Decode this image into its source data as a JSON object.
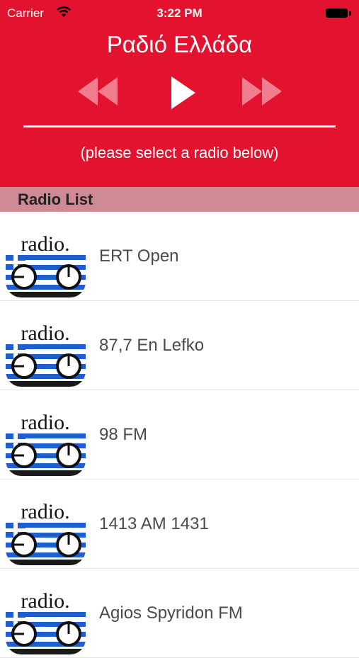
{
  "status_bar": {
    "carrier": "Carrier",
    "time": "3:22 PM"
  },
  "player": {
    "title": "Ραδιό Ελλάδα",
    "hint": "(please select a radio below)",
    "controls": {
      "rewind": "rewind-icon",
      "play": "play-icon",
      "forward": "fast-forward-icon"
    }
  },
  "section": {
    "title": "Radio List"
  },
  "radios": [
    {
      "name": "ERT Open",
      "icon_text": "radio."
    },
    {
      "name": "87,7 En Lefko",
      "icon_text": "radio."
    },
    {
      "name": "98 FM",
      "icon_text": "radio."
    },
    {
      "name": "1413 AM 1431",
      "icon_text": "radio."
    },
    {
      "name": "Agios Spyridon FM",
      "icon_text": "radio."
    }
  ],
  "colors": {
    "header": "#e3132f",
    "section": "#d08a94",
    "flag_blue": "#1d5fd0"
  }
}
